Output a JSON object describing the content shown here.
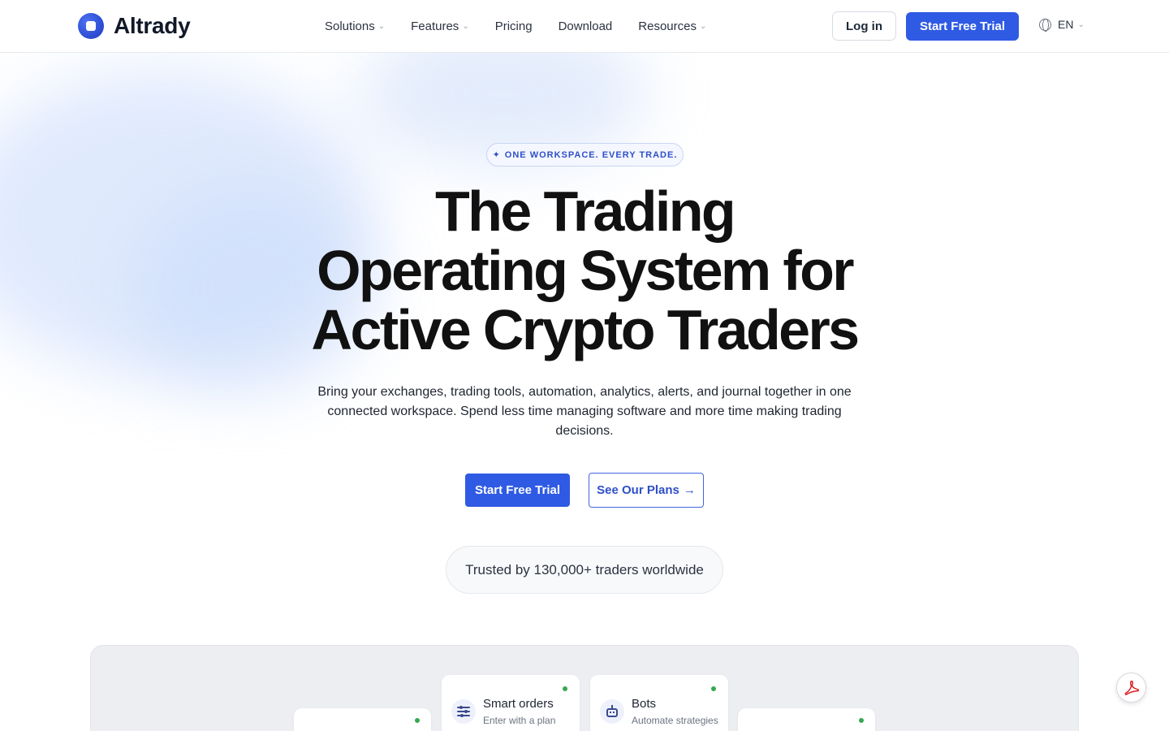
{
  "header": {
    "logo_text": "Altrady",
    "nav": [
      {
        "label": "Solutions",
        "dropdown": true
      },
      {
        "label": "Features",
        "dropdown": true
      },
      {
        "label": "Pricing",
        "dropdown": false
      },
      {
        "label": "Download",
        "dropdown": false
      },
      {
        "label": "Resources",
        "dropdown": true
      }
    ],
    "login_label": "Log in",
    "trial_label": "Start Free Trial",
    "language": "EN"
  },
  "hero": {
    "badge": "ONE WORKSPACE. EVERY TRADE.",
    "title_lines": [
      "The Trading",
      "Operating System for",
      "Active Crypto Traders"
    ],
    "subtitle": "Bring your exchanges, trading tools, automation, analytics, alerts, and journal together in one connected workspace. Spend less time managing software and more time making trading decisions.",
    "cta_primary": "Start Free Trial",
    "cta_secondary": "See Our Plans",
    "trusted": "Trusted by 130,000+ traders worldwide"
  },
  "preview": {
    "cards": [
      {
        "title": "Smart orders",
        "desc": "Enter with a plan",
        "icon": "sliders-icon"
      },
      {
        "title": "Bots",
        "desc": "Automate strategies",
        "icon": "robot-icon"
      }
    ]
  },
  "colors": {
    "accent": "#2f5ae3",
    "status_online": "#35a852",
    "pdf_red": "#d81e1e"
  }
}
